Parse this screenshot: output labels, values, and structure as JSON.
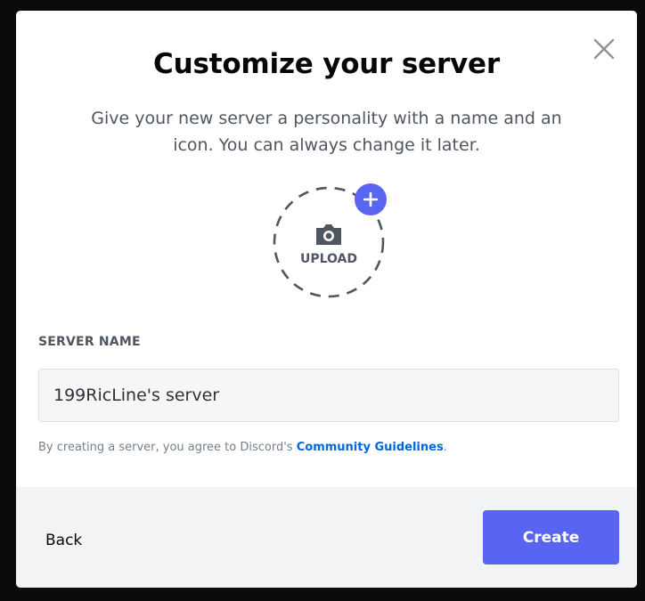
{
  "modal": {
    "title": "Customize your server",
    "subtitle": "Give your new server a personality with a name and an icon. You can always change it later.",
    "close_icon": "close-icon"
  },
  "upload": {
    "label": "UPLOAD",
    "camera_icon": "camera-icon",
    "plus_icon": "plus-icon"
  },
  "server_name": {
    "label": "SERVER NAME",
    "value": "199RicLine's server"
  },
  "terms": {
    "prefix": "By creating a server, you agree to Discord's ",
    "link": "Community Guidelines",
    "suffix": "."
  },
  "footer": {
    "back_label": "Back",
    "create_label": "Create"
  },
  "colors": {
    "accent": "#5865f2",
    "link": "#0067e0",
    "footer_bg": "#f2f3f5"
  }
}
